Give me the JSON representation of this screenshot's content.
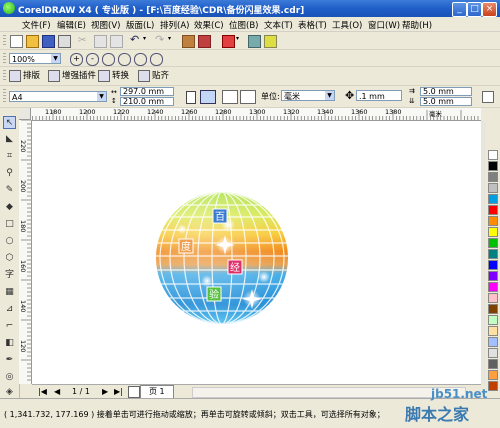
{
  "window": {
    "title": "CorelDRAW X4 ( 专业版 ) - [F:\\百度经验\\CDR\\备份闪星效果.cdr]",
    "controls": [
      "_",
      "□",
      "×"
    ]
  },
  "menu": [
    "文件(F)",
    "编辑(E)",
    "视图(V)",
    "版面(L)",
    "排列(A)",
    "效果(C)",
    "位图(B)",
    "文本(T)",
    "表格(T)",
    "工具(O)",
    "窗口(W)",
    "帮助(H)"
  ],
  "zoom": {
    "value": "100%"
  },
  "plugins": [
    "排版",
    "增强插件",
    "转换",
    "贴齐"
  ],
  "property_bar": {
    "paper": "A4",
    "width": "297.0 mm",
    "height": "210.0 mm",
    "units_label": "单位:",
    "units": "毫米",
    "nudge": ".1 mm",
    "dup_x": "5.0 mm",
    "dup_y": "5.0 mm"
  },
  "ruler": {
    "h_labels": [
      "1180",
      "1200",
      "1220",
      "1240",
      "1260",
      "1280",
      "1300",
      "1320",
      "1340",
      "1360",
      "1380"
    ],
    "v_labels": [
      "220",
      "200",
      "180",
      "160",
      "140",
      "120"
    ],
    "units_label": "毫米"
  },
  "ball_labels": [
    "百",
    "度",
    "经",
    "验"
  ],
  "page_nav": {
    "counter": "1 / 1",
    "tab": "页 1"
  },
  "status": {
    "text": "( 1,341.732, 177.169 ) 接着单击可进行拖动或缩放；再单击可旋转或倾斜；双击工具，可选择所有对象；按住 Shi..."
  },
  "watermark": {
    "site": "jb51.net",
    "name": "脚本之家"
  },
  "colors": {
    "titlebar": "#245edb",
    "palette": [
      "#ffffff",
      "#000000",
      "#808080",
      "#c0c0c0",
      "#00a0e0",
      "#ff0000",
      "#ff8c00",
      "#ffff00",
      "#00c000",
      "#008080",
      "#0000ff",
      "#8000ff",
      "#ff00ff",
      "#ffc0cb",
      "#804000",
      "#c0ffc0",
      "#ffe0a0",
      "#a0c0ff",
      "#e0e0e0",
      "#606060",
      "#ffa040",
      "#c04000"
    ]
  }
}
